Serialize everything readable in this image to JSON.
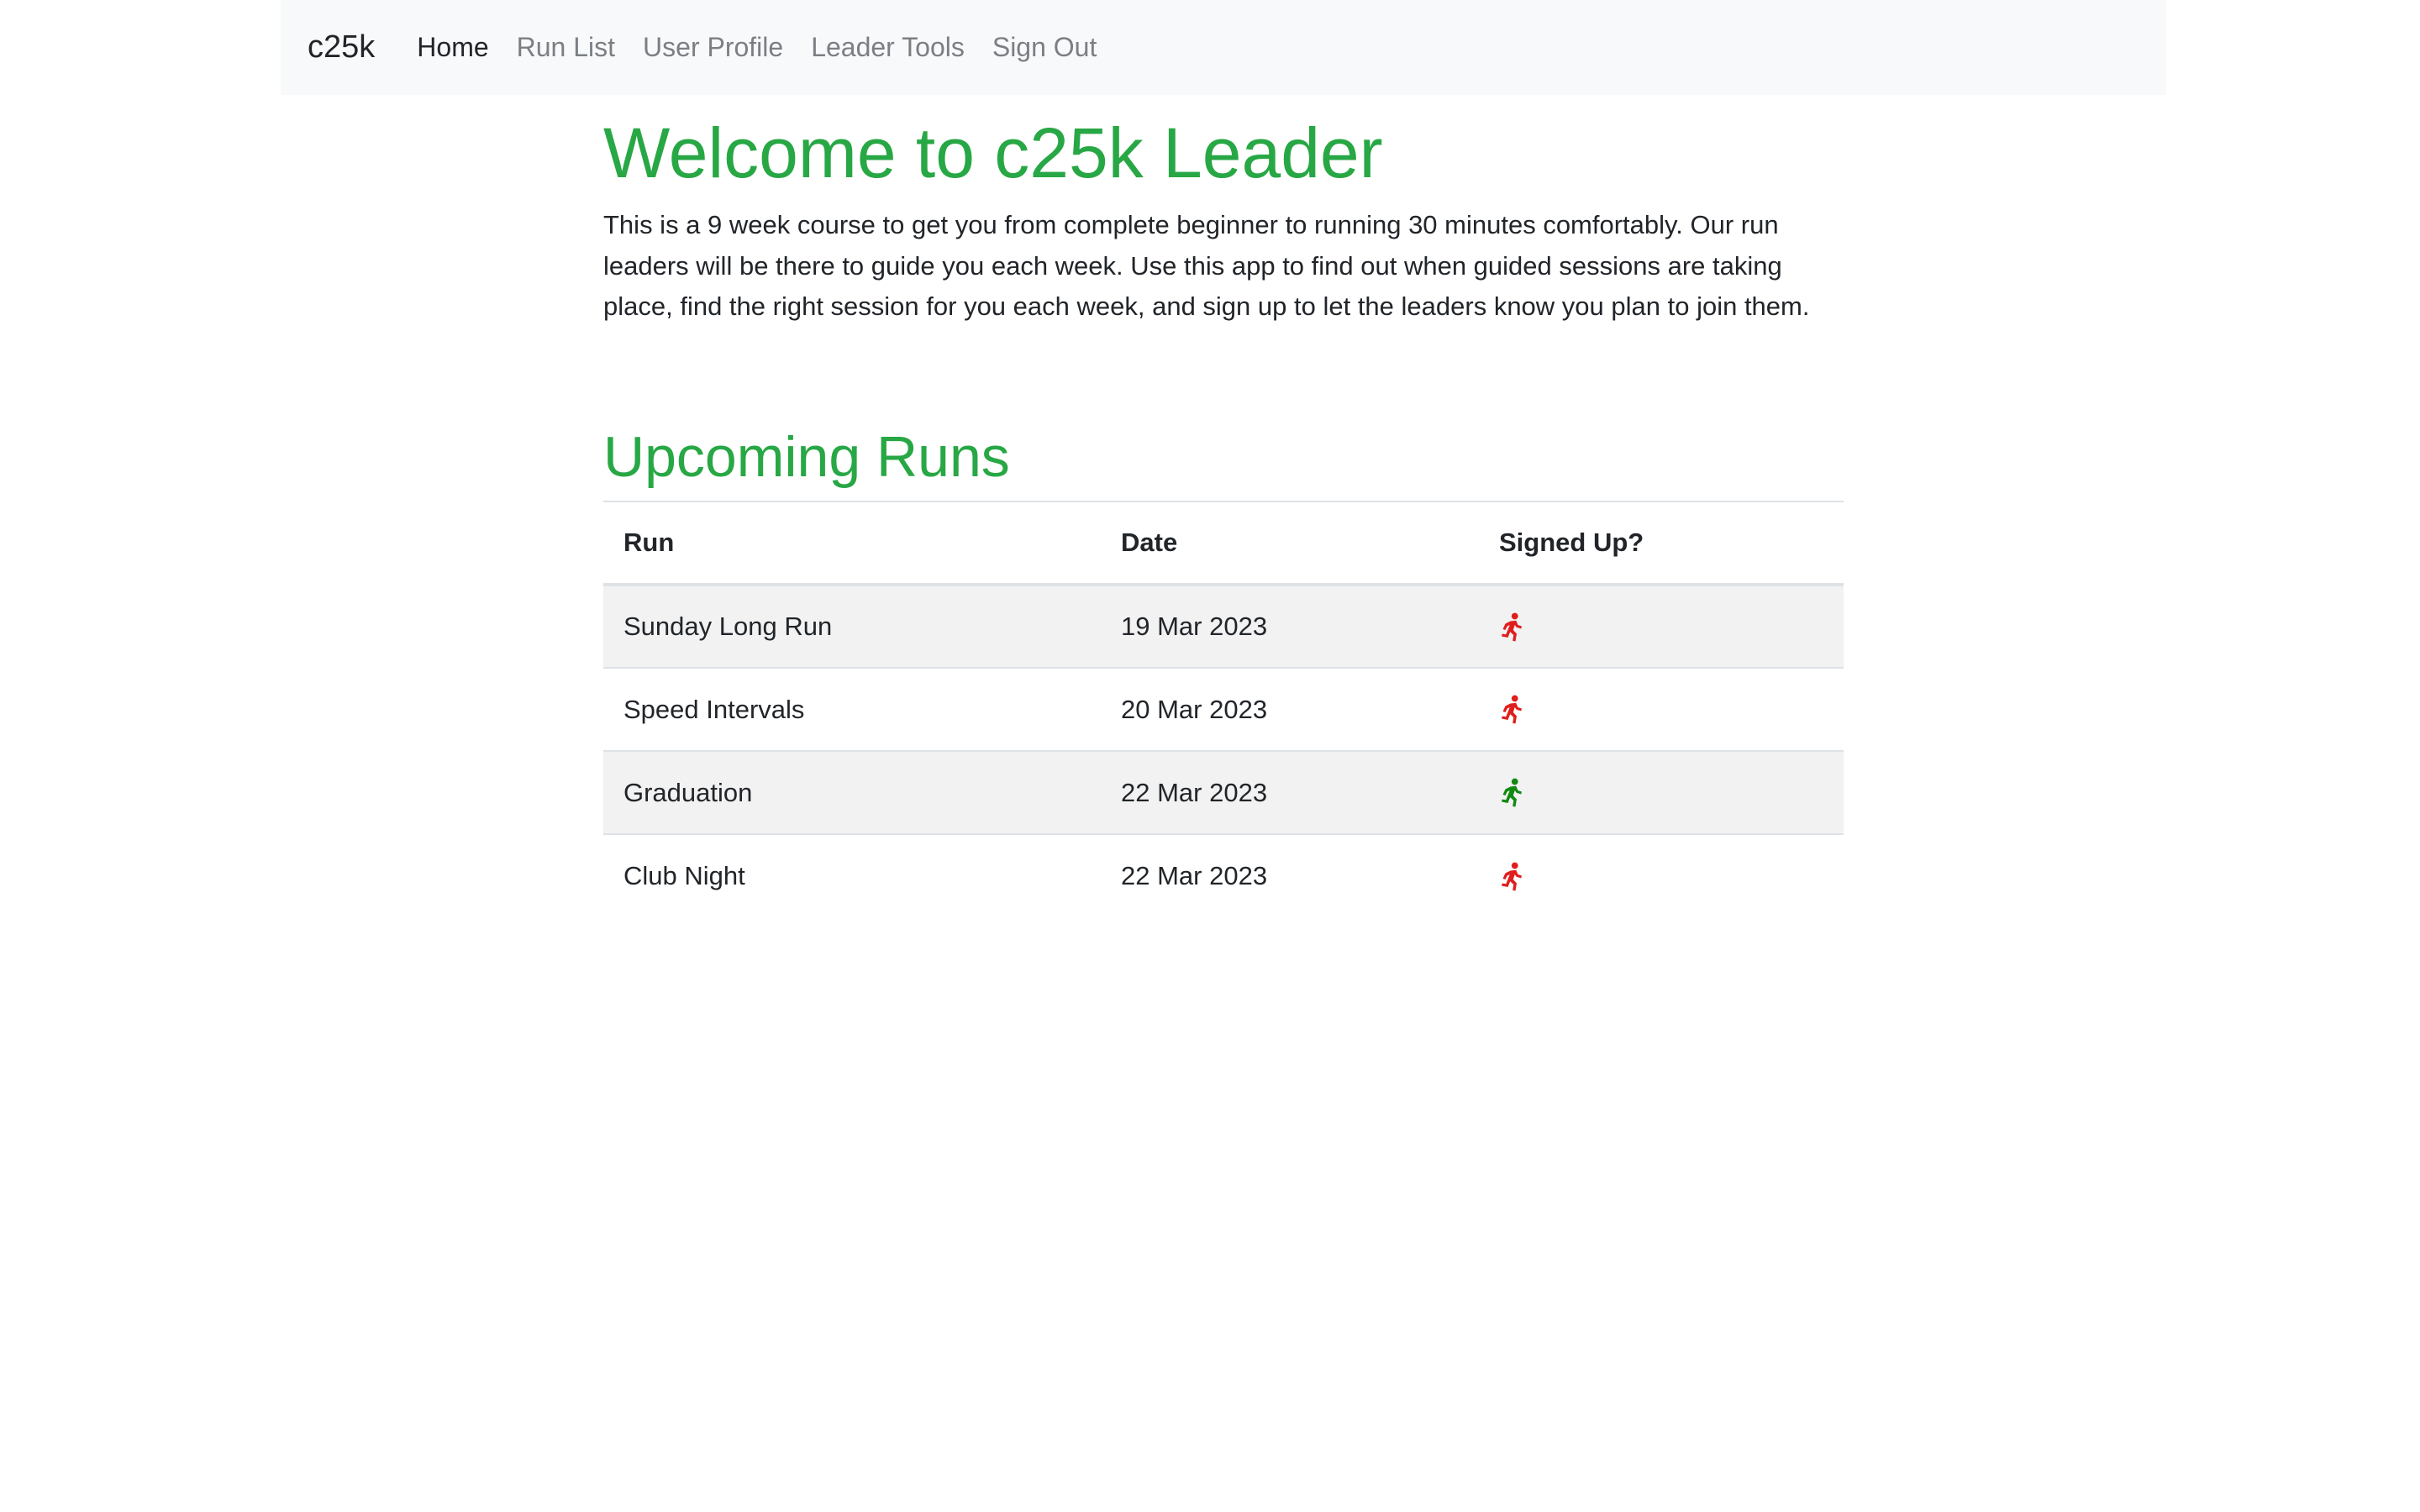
{
  "nav": {
    "brand": "c25k",
    "items": [
      {
        "label": "Home",
        "active": true
      },
      {
        "label": "Run List",
        "active": false
      },
      {
        "label": "User Profile",
        "active": false
      },
      {
        "label": "Leader Tools",
        "active": false
      },
      {
        "label": "Sign Out",
        "active": false
      }
    ]
  },
  "main": {
    "title": "Welcome to c25k Leader",
    "intro": "This is a 9 week course to get you from complete beginner to running 30 minutes comfortably. Our run leaders will be there to guide you each week. Use this app to find out when guided sessions are taking place, find the right session for you each week, and sign up to let the leaders know you plan to join them.",
    "section_title": "Upcoming Runs",
    "table": {
      "headers": [
        "Run",
        "Date",
        "Signed Up?"
      ],
      "rows": [
        {
          "run": "Sunday Long Run",
          "date": "19 Mar 2023",
          "signed_up": false,
          "icon": "running-person-icon",
          "icon_color": "#e01e1e"
        },
        {
          "run": "Speed Intervals",
          "date": "20 Mar 2023",
          "signed_up": false,
          "icon": "running-person-icon",
          "icon_color": "#e01e1e"
        },
        {
          "run": "Graduation",
          "date": "22 Mar 2023",
          "signed_up": true,
          "icon": "running-person-icon",
          "icon_color": "#128a12"
        },
        {
          "run": "Club Night",
          "date": "22 Mar 2023",
          "signed_up": false,
          "icon": "running-person-icon",
          "icon_color": "#e01e1e"
        }
      ]
    }
  },
  "colors": {
    "accent": "#28a745",
    "navbar_bg": "#f8f9fa",
    "stripe": "#f2f2f2"
  }
}
